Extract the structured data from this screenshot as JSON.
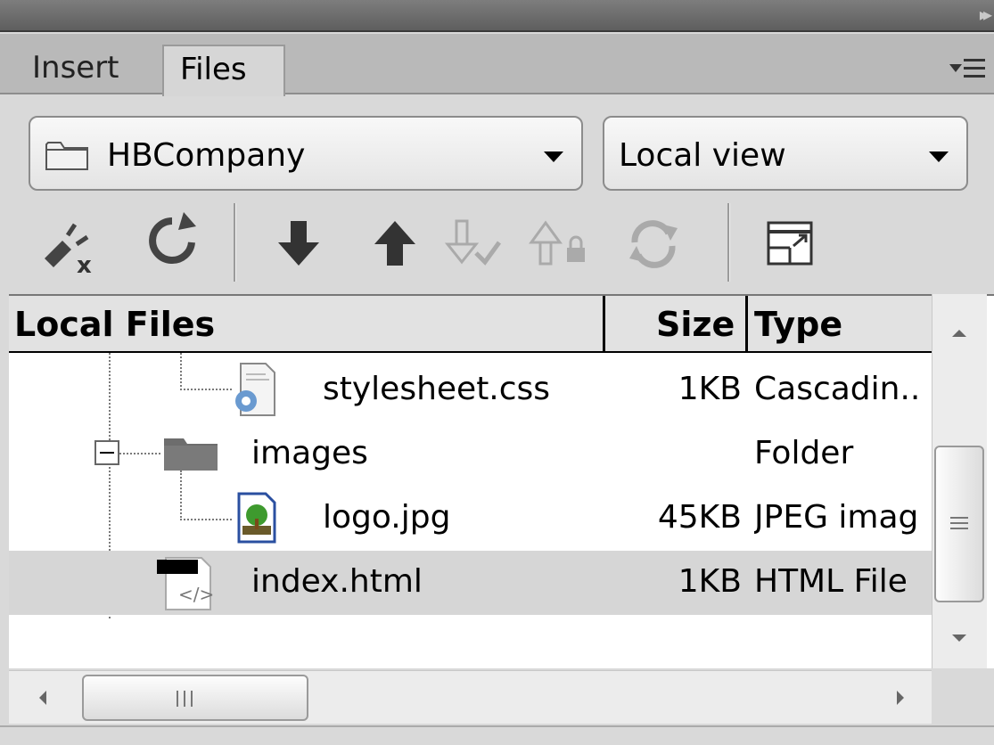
{
  "tabs": [
    {
      "label": "Insert",
      "active": false
    },
    {
      "label": "Files",
      "active": true
    }
  ],
  "site_selector": {
    "value": "HBCompany"
  },
  "view_selector": {
    "value": "Local view"
  },
  "toolbar": {
    "buttons": [
      "disconnect-icon",
      "refresh-icon",
      "get-files-icon",
      "put-files-icon",
      "check-out-icon",
      "check-in-icon",
      "synchronize-icon",
      "expand-panel-icon"
    ]
  },
  "columns": {
    "name": "Local Files",
    "size": "Size",
    "type": "Type"
  },
  "rows": [
    {
      "name": "stylesheet.css",
      "size": "1KB",
      "type": "Cascadin..",
      "icon": "css-file-icon",
      "selected": false
    },
    {
      "name": "images",
      "size": "",
      "type": "Folder",
      "icon": "folder-icon",
      "selected": false
    },
    {
      "name": "logo.jpg",
      "size": "45KB",
      "type": "JPEG imag",
      "icon": "jpeg-file-icon",
      "selected": false
    },
    {
      "name": "index.html",
      "size": "1KB",
      "type": "HTML File",
      "icon": "html-file-icon",
      "selected": true
    }
  ],
  "colors": {
    "selected_row": "#d6d6d6",
    "panel_bg": "#d9d9d9",
    "header_bg": "#e2e2e2"
  }
}
